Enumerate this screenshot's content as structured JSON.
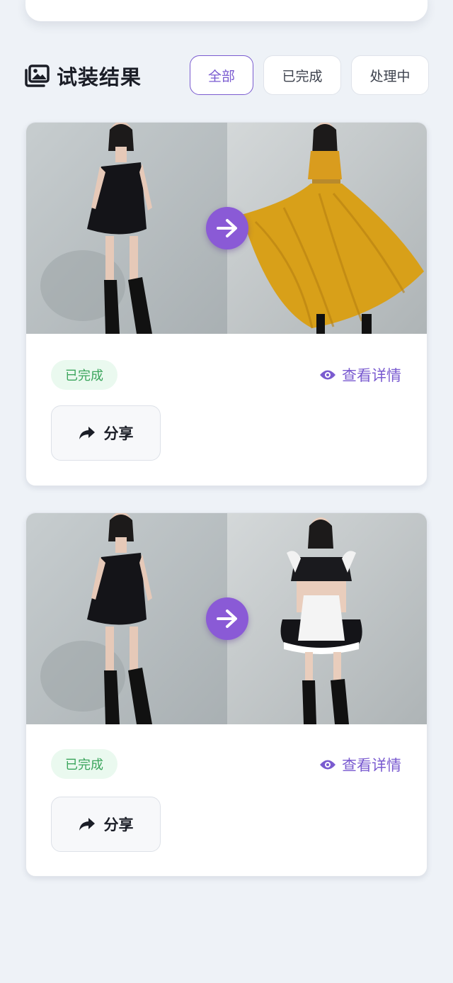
{
  "section": {
    "title": "试装结果",
    "title_icon": "images-icon"
  },
  "filters": [
    {
      "label": "全部",
      "active": true
    },
    {
      "label": "已完成",
      "active": false
    },
    {
      "label": "处理中",
      "active": false
    }
  ],
  "results": [
    {
      "before_image": "woman-black-strapless-dress",
      "after_image": "woman-yellow-halter-maxi-dress",
      "status": "已完成",
      "detail_label": "查看详情",
      "share_label": "分享"
    },
    {
      "before_image": "woman-black-strapless-dress",
      "after_image": "woman-maid-outfit",
      "status": "已完成",
      "detail_label": "查看详情",
      "share_label": "分享"
    }
  ],
  "colors": {
    "accent": "#7a5bd0",
    "arrow_bg": "#8a5ad6",
    "status_bg": "#eaf9ef",
    "status_text": "#3ba55c",
    "page_bg": "#eef2f7"
  }
}
